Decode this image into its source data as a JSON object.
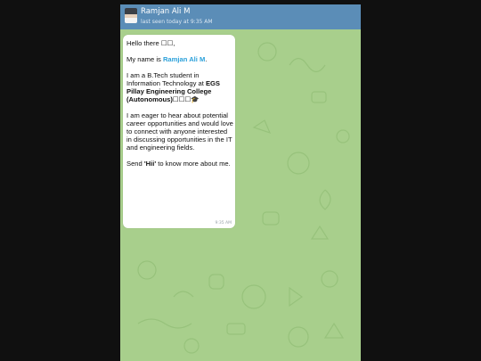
{
  "header": {
    "title": "Ramjan Ali M",
    "status": "last seen today at 9:35 AM"
  },
  "message": {
    "greeting": "Hello there ☐☐,",
    "name_prefix": "My name is ",
    "name": "Ramjan Ali M",
    "name_suffix": ".",
    "intro_prefix": "I am a B.Tech student in Information Technology at ",
    "college": "EGS Pillay Engineering College (Autonomous)",
    "intro_suffix": "☐☐☐🎓",
    "interest": "I am eager to hear about potential career opportunities and would love to connect with anyone interested in discussing opportunities in the IT and engineering fields.",
    "send_prefix": "Send ",
    "keyword": "'Hii'",
    "send_suffix": " to know more about me.",
    "time": "9:35 AM"
  },
  "colors": {
    "header": "#5b8db7",
    "wallpaper": "#a8cf8c",
    "highlight": "#2aa0da"
  }
}
